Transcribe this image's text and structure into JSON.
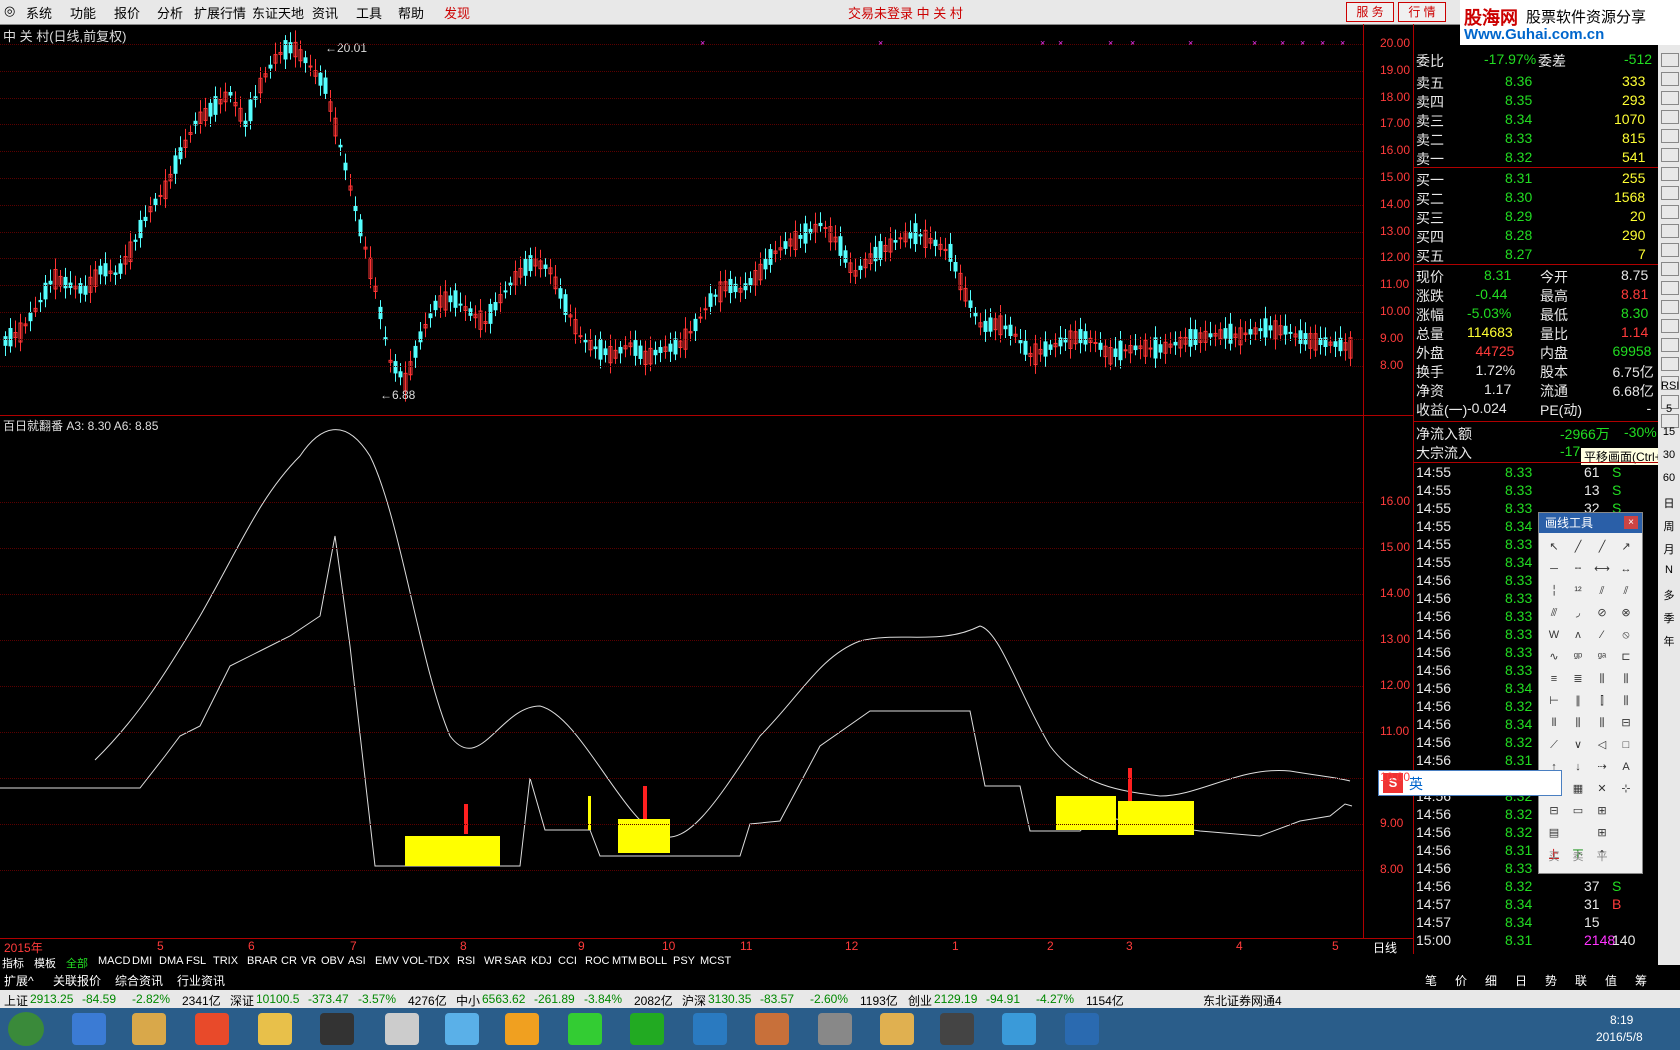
{
  "menu": [
    "系统",
    "功能",
    "报价",
    "分析",
    "扩展行情",
    "东证天地",
    "资讯",
    "工具",
    "帮助",
    "发现"
  ],
  "title_center": "交易未登录   中 关 村",
  "service_buttons": [
    "服 务",
    "行 情"
  ],
  "logo": {
    "name": "股海网",
    "slogan": "股票软件资源分享",
    "url": "Www.Guhai.com.cn"
  },
  "main_chart": {
    "header": "中 关 村(日线,前复权)",
    "high_label": "20.01",
    "low_label": "6.88",
    "y_ticks": [
      "20.00",
      "19.00",
      "18.00",
      "17.00",
      "16.00",
      "15.00",
      "14.00",
      "13.00",
      "12.00",
      "11.00",
      "10.00",
      "9.00",
      "8.00"
    ]
  },
  "indicator": {
    "header": "百日就翻番  A3: 8.30  A6: 8.85",
    "y_ticks": [
      "16.00",
      "15.00",
      "14.00",
      "13.00",
      "12.00",
      "11.00",
      "10.00",
      "9.00",
      "8.00"
    ]
  },
  "x_axis": {
    "labels": [
      "2015年",
      "5",
      "6",
      "7",
      "8",
      "9",
      "10",
      "11",
      "12",
      "1",
      "2",
      "3",
      "4",
      "5"
    ],
    "period": "日线"
  },
  "quote": {
    "weibi": {
      "label": "委比",
      "value": "-17.97%",
      "label2": "委差",
      "value2": "-512"
    },
    "sell": [
      {
        "l": "卖五",
        "p": "8.36",
        "v": "333"
      },
      {
        "l": "卖四",
        "p": "8.35",
        "v": "293"
      },
      {
        "l": "卖三",
        "p": "8.34",
        "v": "1070"
      },
      {
        "l": "卖二",
        "p": "8.33",
        "v": "815"
      },
      {
        "l": "卖一",
        "p": "8.32",
        "v": "541"
      }
    ],
    "buy": [
      {
        "l": "买一",
        "p": "8.31",
        "v": "255"
      },
      {
        "l": "买二",
        "p": "8.30",
        "v": "1568"
      },
      {
        "l": "买三",
        "p": "8.29",
        "v": "20"
      },
      {
        "l": "买四",
        "p": "8.28",
        "v": "290"
      },
      {
        "l": "买五",
        "p": "8.27",
        "v": "7"
      }
    ],
    "stats": [
      {
        "l": "现价",
        "v": "8.31",
        "l2": "今开",
        "v2": "8.75"
      },
      {
        "l": "涨跌",
        "v": "-0.44",
        "l2": "最高",
        "v2": "8.81"
      },
      {
        "l": "涨幅",
        "v": "-5.03%",
        "l2": "最低",
        "v2": "8.30"
      },
      {
        "l": "总量",
        "v": "114683",
        "l2": "量比",
        "v2": "1.14"
      },
      {
        "l": "外盘",
        "v": "44725",
        "l2": "内盘",
        "v2": "69958"
      },
      {
        "l": "换手",
        "v": "1.72%",
        "l2": "股本",
        "v2": "6.75亿"
      },
      {
        "l": "净资",
        "v": "1.17",
        "l2": "流通",
        "v2": "6.68亿"
      },
      {
        "l": "收益(一)",
        "v": "-0.024",
        "l2": "PE(动)",
        "v2": "-"
      }
    ],
    "flow": [
      {
        "l": "净流入额",
        "v": "-2966万",
        "v2": "-30%"
      },
      {
        "l": "大宗流入",
        "v": "-17"
      }
    ]
  },
  "ticks": [
    {
      "t": "14:55",
      "p": "8.33",
      "v": "61",
      "s": "S"
    },
    {
      "t": "14:55",
      "p": "8.33",
      "v": "13",
      "s": "S"
    },
    {
      "t": "14:55",
      "p": "8.33",
      "v": "32",
      "s": "S"
    },
    {
      "t": "14:55",
      "p": "8.34",
      "v": "",
      "s": ""
    },
    {
      "t": "14:55",
      "p": "8.33",
      "v": "",
      "s": ""
    },
    {
      "t": "14:55",
      "p": "8.34",
      "v": "",
      "s": ""
    },
    {
      "t": "14:56",
      "p": "8.33",
      "v": "",
      "s": ""
    },
    {
      "t": "14:56",
      "p": "8.33",
      "v": "",
      "s": ""
    },
    {
      "t": "14:56",
      "p": "8.33",
      "v": "",
      "s": ""
    },
    {
      "t": "14:56",
      "p": "8.33",
      "v": "",
      "s": ""
    },
    {
      "t": "14:56",
      "p": "8.33",
      "v": "",
      "s": ""
    },
    {
      "t": "14:56",
      "p": "8.33",
      "v": "",
      "s": ""
    },
    {
      "t": "14:56",
      "p": "8.34",
      "v": "",
      "s": ""
    },
    {
      "t": "14:56",
      "p": "8.32",
      "v": "",
      "s": ""
    },
    {
      "t": "14:56",
      "p": "8.34",
      "v": "",
      "s": ""
    },
    {
      "t": "14:56",
      "p": "8.32",
      "v": "",
      "s": ""
    },
    {
      "t": "14:56",
      "p": "8.31",
      "v": "",
      "s": ""
    },
    {
      "t": "14:56",
      "p": "8.32",
      "v": "",
      "s": ""
    },
    {
      "t": "14:56",
      "p": "8.32",
      "v": "",
      "s": ""
    },
    {
      "t": "14:56",
      "p": "8.32",
      "v": "",
      "s": ""
    },
    {
      "t": "14:56",
      "p": "8.32",
      "v": "",
      "s": ""
    },
    {
      "t": "14:56",
      "p": "8.31",
      "v": "",
      "s": ""
    },
    {
      "t": "14:56",
      "p": "8.33",
      "v": "25",
      "s": "B"
    },
    {
      "t": "14:56",
      "p": "8.32",
      "v": "37",
      "s": "S"
    },
    {
      "t": "14:57",
      "p": "8.34",
      "v": "31",
      "s": "B"
    },
    {
      "t": "14:57",
      "p": "8.34",
      "v": "15",
      "s": ""
    },
    {
      "t": "15:00",
      "p": "8.31",
      "v": "2148",
      "s": "140"
    }
  ],
  "tooltip": "平移画面(Ctrl+0)",
  "draw_tool_title": "画线工具",
  "draw_tool_bottom": [
    "买",
    "卖",
    "平"
  ],
  "tabs_row1": [
    "指标",
    "模板",
    "全部",
    "MACD",
    "DMI",
    "DMA",
    "FSL",
    "TRIX",
    "BRAR",
    "CR",
    "VR",
    "OBV",
    "ASI",
    "EMV",
    "VOL-TDX",
    "RSI",
    "WR",
    "SAR",
    "KDJ",
    "CCI",
    "ROC",
    "MTM",
    "BOLL",
    "PSY",
    "MCST"
  ],
  "tabs_row2": [
    "扩展^",
    "关联报价",
    "综合资讯",
    "行业资讯"
  ],
  "bottom_nav": [
    "笔",
    "价",
    "细",
    "日",
    "势",
    "联",
    "值",
    "筹"
  ],
  "status": [
    {
      "n": "上证",
      "v": "2913.25",
      "c": "-84.59",
      "p": "-2.82%",
      "a": "2341亿"
    },
    {
      "n": "深证",
      "v": "10100.5",
      "c": "-373.47",
      "p": "-3.57%",
      "a": "4276亿"
    },
    {
      "n": "中小",
      "v": "6563.62",
      "c": "-261.89",
      "p": "-3.84%",
      "a": "2082亿"
    },
    {
      "n": "沪深",
      "v": "3130.35",
      "c": "-83.57",
      "p": "-2.60%",
      "a": "1193亿"
    },
    {
      "n": "创业",
      "v": "2129.19",
      "c": "-94.91",
      "p": "-4.27%",
      "a": "1154亿"
    }
  ],
  "broker": "东北证券网通4",
  "ime": "英",
  "clock": {
    "time": "8:19",
    "date": "2016/5/8"
  },
  "right_tools": [
    "RSI",
    "5",
    "15",
    "30",
    "60",
    "日",
    "周",
    "月",
    "N",
    "多",
    "季",
    "年"
  ]
}
